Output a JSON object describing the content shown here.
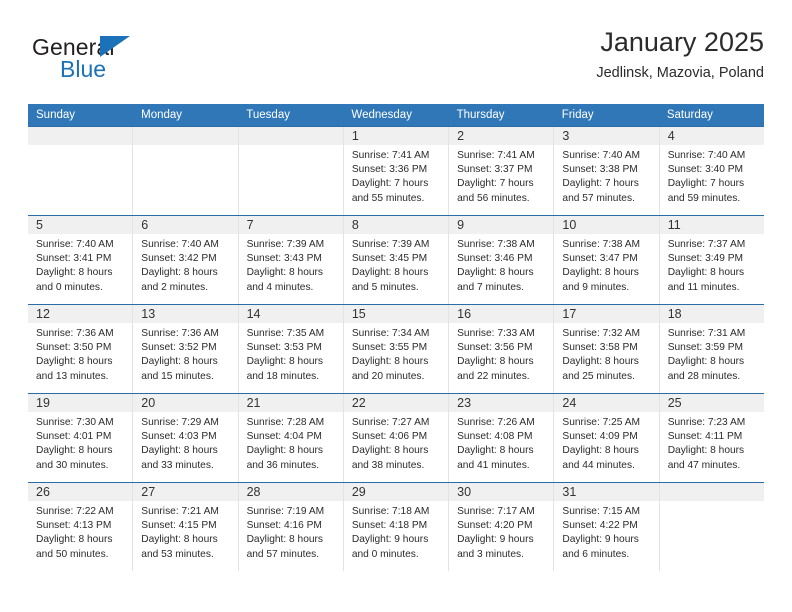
{
  "brand": {
    "name_top": "General",
    "name_bottom": "Blue",
    "triangle_icon": "triangle-icon",
    "color_blue": "#1b72b8",
    "color_dark": "#231f20"
  },
  "header": {
    "title": "January 2025",
    "subtitle": "Jedlinsk, Mazovia, Poland"
  },
  "theme": {
    "header_blue": "#3077b8",
    "row_border_blue": "#2a6ca8",
    "day_band_gray": "#f0f0f0",
    "cell_border": "#e3e3e3"
  },
  "weekdays": [
    "Sunday",
    "Monday",
    "Tuesday",
    "Wednesday",
    "Thursday",
    "Friday",
    "Saturday"
  ],
  "weeks": [
    [
      {
        "day": "",
        "sunrise": "",
        "sunset": "",
        "daylight1": "",
        "daylight2": "",
        "empty": true
      },
      {
        "day": "",
        "sunrise": "",
        "sunset": "",
        "daylight1": "",
        "daylight2": "",
        "empty": true
      },
      {
        "day": "",
        "sunrise": "",
        "sunset": "",
        "daylight1": "",
        "daylight2": "",
        "empty": true
      },
      {
        "day": "1",
        "sunrise": "Sunrise: 7:41 AM",
        "sunset": "Sunset: 3:36 PM",
        "daylight1": "Daylight: 7 hours",
        "daylight2": "and 55 minutes."
      },
      {
        "day": "2",
        "sunrise": "Sunrise: 7:41 AM",
        "sunset": "Sunset: 3:37 PM",
        "daylight1": "Daylight: 7 hours",
        "daylight2": "and 56 minutes."
      },
      {
        "day": "3",
        "sunrise": "Sunrise: 7:40 AM",
        "sunset": "Sunset: 3:38 PM",
        "daylight1": "Daylight: 7 hours",
        "daylight2": "and 57 minutes."
      },
      {
        "day": "4",
        "sunrise": "Sunrise: 7:40 AM",
        "sunset": "Sunset: 3:40 PM",
        "daylight1": "Daylight: 7 hours",
        "daylight2": "and 59 minutes."
      }
    ],
    [
      {
        "day": "5",
        "sunrise": "Sunrise: 7:40 AM",
        "sunset": "Sunset: 3:41 PM",
        "daylight1": "Daylight: 8 hours",
        "daylight2": "and 0 minutes."
      },
      {
        "day": "6",
        "sunrise": "Sunrise: 7:40 AM",
        "sunset": "Sunset: 3:42 PM",
        "daylight1": "Daylight: 8 hours",
        "daylight2": "and 2 minutes."
      },
      {
        "day": "7",
        "sunrise": "Sunrise: 7:39 AM",
        "sunset": "Sunset: 3:43 PM",
        "daylight1": "Daylight: 8 hours",
        "daylight2": "and 4 minutes."
      },
      {
        "day": "8",
        "sunrise": "Sunrise: 7:39 AM",
        "sunset": "Sunset: 3:45 PM",
        "daylight1": "Daylight: 8 hours",
        "daylight2": "and 5 minutes."
      },
      {
        "day": "9",
        "sunrise": "Sunrise: 7:38 AM",
        "sunset": "Sunset: 3:46 PM",
        "daylight1": "Daylight: 8 hours",
        "daylight2": "and 7 minutes."
      },
      {
        "day": "10",
        "sunrise": "Sunrise: 7:38 AM",
        "sunset": "Sunset: 3:47 PM",
        "daylight1": "Daylight: 8 hours",
        "daylight2": "and 9 minutes."
      },
      {
        "day": "11",
        "sunrise": "Sunrise: 7:37 AM",
        "sunset": "Sunset: 3:49 PM",
        "daylight1": "Daylight: 8 hours",
        "daylight2": "and 11 minutes."
      }
    ],
    [
      {
        "day": "12",
        "sunrise": "Sunrise: 7:36 AM",
        "sunset": "Sunset: 3:50 PM",
        "daylight1": "Daylight: 8 hours",
        "daylight2": "and 13 minutes."
      },
      {
        "day": "13",
        "sunrise": "Sunrise: 7:36 AM",
        "sunset": "Sunset: 3:52 PM",
        "daylight1": "Daylight: 8 hours",
        "daylight2": "and 15 minutes."
      },
      {
        "day": "14",
        "sunrise": "Sunrise: 7:35 AM",
        "sunset": "Sunset: 3:53 PM",
        "daylight1": "Daylight: 8 hours",
        "daylight2": "and 18 minutes."
      },
      {
        "day": "15",
        "sunrise": "Sunrise: 7:34 AM",
        "sunset": "Sunset: 3:55 PM",
        "daylight1": "Daylight: 8 hours",
        "daylight2": "and 20 minutes."
      },
      {
        "day": "16",
        "sunrise": "Sunrise: 7:33 AM",
        "sunset": "Sunset: 3:56 PM",
        "daylight1": "Daylight: 8 hours",
        "daylight2": "and 22 minutes."
      },
      {
        "day": "17",
        "sunrise": "Sunrise: 7:32 AM",
        "sunset": "Sunset: 3:58 PM",
        "daylight1": "Daylight: 8 hours",
        "daylight2": "and 25 minutes."
      },
      {
        "day": "18",
        "sunrise": "Sunrise: 7:31 AM",
        "sunset": "Sunset: 3:59 PM",
        "daylight1": "Daylight: 8 hours",
        "daylight2": "and 28 minutes."
      }
    ],
    [
      {
        "day": "19",
        "sunrise": "Sunrise: 7:30 AM",
        "sunset": "Sunset: 4:01 PM",
        "daylight1": "Daylight: 8 hours",
        "daylight2": "and 30 minutes."
      },
      {
        "day": "20",
        "sunrise": "Sunrise: 7:29 AM",
        "sunset": "Sunset: 4:03 PM",
        "daylight1": "Daylight: 8 hours",
        "daylight2": "and 33 minutes."
      },
      {
        "day": "21",
        "sunrise": "Sunrise: 7:28 AM",
        "sunset": "Sunset: 4:04 PM",
        "daylight1": "Daylight: 8 hours",
        "daylight2": "and 36 minutes."
      },
      {
        "day": "22",
        "sunrise": "Sunrise: 7:27 AM",
        "sunset": "Sunset: 4:06 PM",
        "daylight1": "Daylight: 8 hours",
        "daylight2": "and 38 minutes."
      },
      {
        "day": "23",
        "sunrise": "Sunrise: 7:26 AM",
        "sunset": "Sunset: 4:08 PM",
        "daylight1": "Daylight: 8 hours",
        "daylight2": "and 41 minutes."
      },
      {
        "day": "24",
        "sunrise": "Sunrise: 7:25 AM",
        "sunset": "Sunset: 4:09 PM",
        "daylight1": "Daylight: 8 hours",
        "daylight2": "and 44 minutes."
      },
      {
        "day": "25",
        "sunrise": "Sunrise: 7:23 AM",
        "sunset": "Sunset: 4:11 PM",
        "daylight1": "Daylight: 8 hours",
        "daylight2": "and 47 minutes."
      }
    ],
    [
      {
        "day": "26",
        "sunrise": "Sunrise: 7:22 AM",
        "sunset": "Sunset: 4:13 PM",
        "daylight1": "Daylight: 8 hours",
        "daylight2": "and 50 minutes."
      },
      {
        "day": "27",
        "sunrise": "Sunrise: 7:21 AM",
        "sunset": "Sunset: 4:15 PM",
        "daylight1": "Daylight: 8 hours",
        "daylight2": "and 53 minutes."
      },
      {
        "day": "28",
        "sunrise": "Sunrise: 7:19 AM",
        "sunset": "Sunset: 4:16 PM",
        "daylight1": "Daylight: 8 hours",
        "daylight2": "and 57 minutes."
      },
      {
        "day": "29",
        "sunrise": "Sunrise: 7:18 AM",
        "sunset": "Sunset: 4:18 PM",
        "daylight1": "Daylight: 9 hours",
        "daylight2": "and 0 minutes."
      },
      {
        "day": "30",
        "sunrise": "Sunrise: 7:17 AM",
        "sunset": "Sunset: 4:20 PM",
        "daylight1": "Daylight: 9 hours",
        "daylight2": "and 3 minutes."
      },
      {
        "day": "31",
        "sunrise": "Sunrise: 7:15 AM",
        "sunset": "Sunset: 4:22 PM",
        "daylight1": "Daylight: 9 hours",
        "daylight2": "and 6 minutes."
      },
      {
        "day": "",
        "sunrise": "",
        "sunset": "",
        "daylight1": "",
        "daylight2": "",
        "empty": true
      }
    ]
  ]
}
